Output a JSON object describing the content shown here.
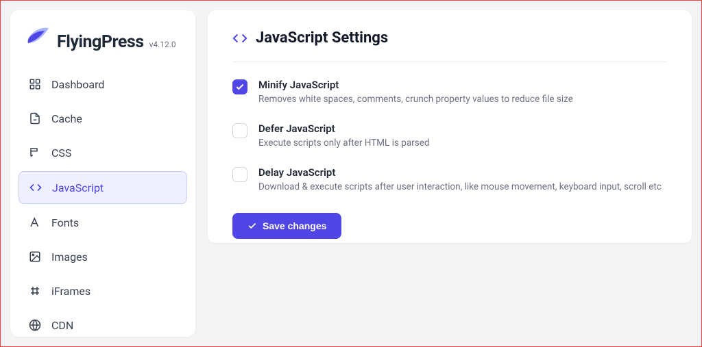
{
  "brand": {
    "name": "FlyingPress",
    "version": "v4.12.0"
  },
  "sidebar": {
    "items": [
      {
        "id": "dashboard",
        "label": "Dashboard",
        "icon": "dashboard-icon",
        "active": false
      },
      {
        "id": "cache",
        "label": "Cache",
        "icon": "cache-icon",
        "active": false
      },
      {
        "id": "css",
        "label": "CSS",
        "icon": "css-icon",
        "active": false
      },
      {
        "id": "javascript",
        "label": "JavaScript",
        "icon": "code-icon",
        "active": true
      },
      {
        "id": "fonts",
        "label": "Fonts",
        "icon": "fonts-icon",
        "active": false
      },
      {
        "id": "images",
        "label": "Images",
        "icon": "images-icon",
        "active": false
      },
      {
        "id": "iframes",
        "label": "iFrames",
        "icon": "iframes-icon",
        "active": false
      },
      {
        "id": "cdn",
        "label": "CDN",
        "icon": "cdn-icon",
        "active": false
      }
    ]
  },
  "page": {
    "title": "JavaScript Settings",
    "settings": [
      {
        "id": "minify",
        "label": "Minify JavaScript",
        "description": "Removes white spaces, comments, crunch property values to reduce file size",
        "checked": true
      },
      {
        "id": "defer",
        "label": "Defer JavaScript",
        "description": "Execute scripts only after HTML is parsed",
        "checked": false
      },
      {
        "id": "delay",
        "label": "Delay JavaScript",
        "description": "Download & execute scripts after user interaction, like mouse movement, keyboard input, scroll etc",
        "checked": false
      }
    ],
    "save_label": "Save changes"
  }
}
